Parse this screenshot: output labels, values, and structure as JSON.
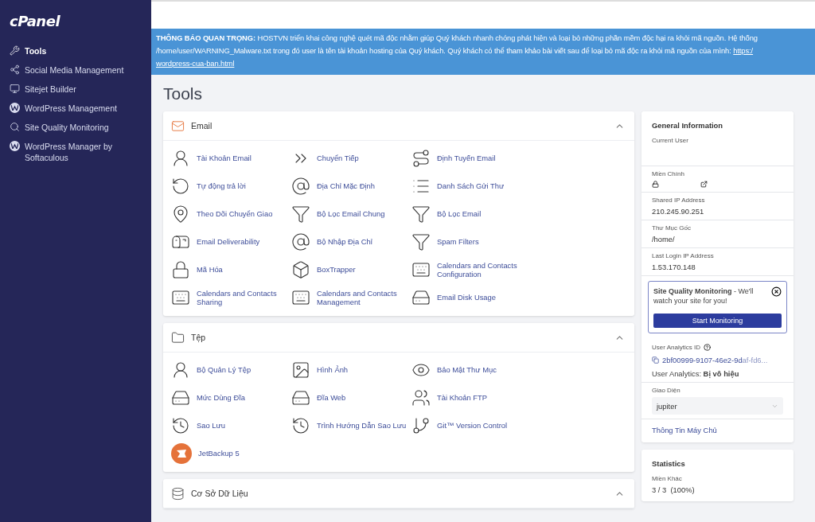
{
  "sidebar": {
    "logo": "cPanel",
    "items": [
      {
        "label": "Tools",
        "selected": true
      },
      {
        "label": "Social Media Management",
        "selected": false
      },
      {
        "label": "Sitejet Builder",
        "selected": false
      },
      {
        "label": "WordPress Management",
        "selected": false
      },
      {
        "label": "Site Quality Monitoring",
        "selected": false
      },
      {
        "label": "WordPress Manager by Softaculous",
        "selected": false
      }
    ]
  },
  "notice": {
    "lines": [
      "**THÔNG BÁO QUAN TRỌNG:** HOSTVN triển khai công nghệ quét mã độc nhằm giúp Quý khách nhanh chóng phát hiện và loại bỏ những phần mềm độc hại ra khỏi mã nguồn. Hệ thống",
      "/home/user/WARNING_Malware.txt trong đó user là tên tài khoản hosting của Quý khách. Quý khách có thể tham khảo bài viết sau để loại bỏ mã độc ra khỏi mã nguồn của mình:"
    ],
    "link": [
      "https:/",
      "wordpress-cua-ban.html"
    ]
  },
  "page_title": "Tools",
  "sections": [
    {
      "title": "Email",
      "expanded": true,
      "tools": [
        "Tài Khoản Email",
        "Chuyển Tiếp",
        "Định Tuyến Email",
        "Tự động trả lời",
        "Địa Chỉ Mặc Định",
        "Danh Sách Gửi Thư",
        "Theo Dõi Chuyển Giao",
        "Bộ Lọc Email Chung",
        "Bộ Lọc Email",
        "Email Deliverability",
        "Bộ Nhập Địa Chỉ",
        "Spam Filters",
        "Mã Hóa",
        "BoxTrapper",
        "Calendars and Contacts Configuration",
        "Calendars and Contacts Sharing",
        "Calendars and Contacts Management",
        "Email Disk Usage"
      ]
    },
    {
      "title": "Tệp",
      "expanded": true,
      "tools": [
        "Bộ Quản Lý Tệp",
        "Hình Ảnh",
        "Bảo Mật Thư Mục",
        "Mức Dùng Đĩa",
        "Đĩa Web",
        "Tài Khoản FTP",
        "Sao Lưu",
        "Trình Hướng Dẫn Sao Lưu",
        "Git™ Version Control",
        "JetBackup 5"
      ]
    },
    {
      "title": "Cơ Sở Dữ Liệu",
      "expanded": true
    }
  ],
  "general_info": {
    "title": "General Information",
    "fields": [
      {
        "label": "Current User"
      },
      {
        "label": "Miền Chính",
        "kind": "domain"
      },
      {
        "label": "Shared IP Address",
        "value": "210.245.90.251"
      },
      {
        "label": "Thư Mục Gốc",
        "value": "/home/"
      },
      {
        "label": "Last Login IP Address",
        "value": "1.53.170.148"
      }
    ],
    "promo": {
      "title": "Site Quality Monitoring",
      "text": " - We'll watch your site for you!",
      "button": "Start Monitoring"
    },
    "analytics": {
      "label": "User Analytics ID",
      "id": "2bf00999-9107-46e2-9d",
      "id_faded": "af-fd6...",
      "status_label": "User Analytics:",
      "status": "Bị vô hiệu"
    },
    "theme": {
      "label": "Giao Diện",
      "value": "jupiter"
    },
    "server_info_link": "Thông Tin Máy Chủ"
  },
  "statistics": {
    "title": "Statistics",
    "items": [
      {
        "label": "Miền Khác",
        "value": "3 / 3",
        "percent": "(100%)"
      }
    ]
  }
}
